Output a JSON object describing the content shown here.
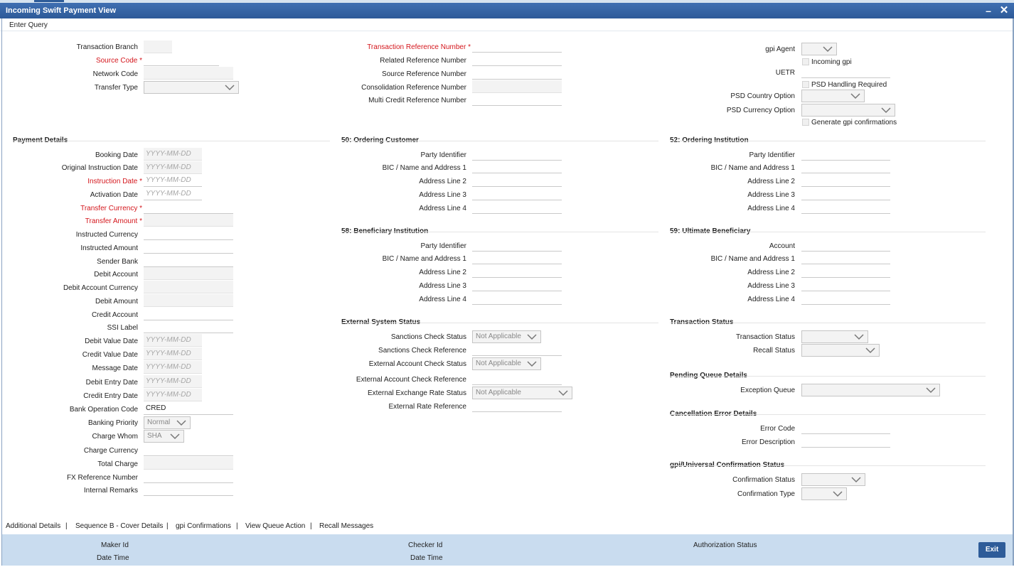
{
  "window": {
    "title": "Incoming Swift Payment View"
  },
  "toolbar": {
    "enter_query": "Enter Query"
  },
  "header": {
    "transaction_branch": "Transaction Branch",
    "source_code": "Source Code",
    "network_code": "Network Code",
    "transfer_type": "Transfer Type",
    "txn_ref_no": "Transaction Reference Number",
    "related_ref_no": "Related Reference Number",
    "source_ref_no": "Source Reference Number",
    "consol_ref_no": "Consolidation Reference Number",
    "multi_credit_ref_no": "Multi Credit Reference Number",
    "gpi_agent": "gpi Agent",
    "incoming_gpi": "Incoming gpi",
    "uetr": "UETR",
    "psd_handling": "PSD Handling Required",
    "psd_country": "PSD Country Option",
    "psd_currency": "PSD Currency Option",
    "gen_gpi_conf": "Generate gpi confirmations"
  },
  "payment": {
    "section": "Payment Details",
    "date_placeholder": "YYYY-MM-DD",
    "booking_date": "Booking Date",
    "orig_instr_date": "Original Instruction Date",
    "instr_date": "Instruction Date",
    "activation_date": "Activation Date",
    "transfer_currency": "Transfer Currency",
    "transfer_amount": "Transfer Amount",
    "instructed_currency": "Instructed Currency",
    "instructed_amount": "Instructed Amount",
    "sender_bank": "Sender Bank",
    "debit_account": "Debit Account",
    "debit_account_ccy": "Debit Account Currency",
    "debit_amount": "Debit Amount",
    "credit_account": "Credit Account",
    "ssi_label": "SSI Label",
    "debit_value_date": "Debit Value Date",
    "credit_value_date": "Credit Value Date",
    "message_date": "Message Date",
    "debit_entry_date": "Debit Entry Date",
    "credit_entry_date": "Credit Entry Date",
    "bank_op_code": "Bank Operation Code",
    "bank_op_code_value": "CRED",
    "banking_priority": "Banking Priority",
    "banking_priority_value": "Normal",
    "charge_whom": "Charge Whom",
    "charge_whom_value": "SHA",
    "charge_currency": "Charge Currency",
    "total_charge": "Total Charge",
    "fx_ref_no": "FX Reference Number",
    "internal_remarks": "Internal Remarks"
  },
  "ordering_customer": {
    "section": "50: Ordering Customer",
    "party_id": "Party Identifier",
    "bic": "BIC / Name and Address 1",
    "addr2": "Address Line 2",
    "addr3": "Address Line 3",
    "addr4": "Address Line 4"
  },
  "ordering_institution": {
    "section": "52: Ordering Institution",
    "party_id": "Party Identifier",
    "bic": "BIC / Name and Address 1",
    "addr2": "Address Line 2",
    "addr3": "Address Line 3",
    "addr4": "Address Line 4"
  },
  "beneficiary_institution": {
    "section": "58: Beneficiary Institution",
    "party_id": "Party Identifier",
    "bic": "BIC / Name and Address 1",
    "addr2": "Address Line 2",
    "addr3": "Address Line 3",
    "addr4": "Address Line 4"
  },
  "ultimate_beneficiary": {
    "section": "59: Ultimate Beneficiary",
    "account": "Account",
    "bic": "BIC / Name and Address 1",
    "addr2": "Address Line 2",
    "addr3": "Address Line 3",
    "addr4": "Address Line 4"
  },
  "external": {
    "section": "External System Status",
    "sanctions_status": "Sanctions Check Status",
    "sanctions_status_value": "Not Applicable",
    "sanctions_ref": "Sanctions Check Reference",
    "ext_acct_status": "External Account Check Status",
    "ext_acct_status_value": "Not Applicable",
    "ext_acct_ref": "External Account Check Reference",
    "ext_fx_status": "External Exchange Rate Status",
    "ext_fx_status_value": "Not Applicable",
    "ext_rate_ref": "External Rate Reference"
  },
  "txn_status": {
    "section": "Transaction Status",
    "transaction_status": "Transaction Status",
    "recall_status": "Recall Status"
  },
  "pending_queue": {
    "section": "Pending Queue Details",
    "exception_queue": "Exception Queue"
  },
  "cancel_error": {
    "section": "Cancellation Error Details",
    "error_code": "Error Code",
    "error_desc": "Error Description"
  },
  "gpi_conf": {
    "section": "gpi/Universal Confirmation Status",
    "conf_status": "Confirmation Status",
    "conf_type": "Confirmation Type"
  },
  "subbar": {
    "links": [
      "Additional Details",
      "Sequence B - Cover Details",
      "gpi Confirmations",
      "View Queue Action",
      "Recall Messages"
    ],
    "separator": "|"
  },
  "footer": {
    "maker_id": "Maker Id",
    "date_time": "Date Time",
    "checker_id": "Checker Id",
    "date_time2": "Date Time",
    "auth_status": "Authorization Status",
    "exit": "Exit"
  }
}
